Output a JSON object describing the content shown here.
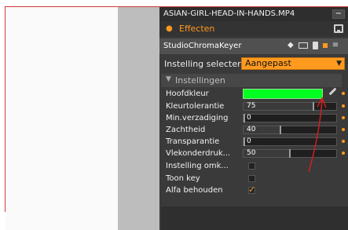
{
  "window": {
    "title": "ASIAN-GIRL-HEAD-IN-HANDS.MP4",
    "minimize_glyph": "−"
  },
  "tab": {
    "label": "Effecten",
    "dot": "●"
  },
  "effect": {
    "name": "StudioChromaKeyer",
    "icons": [
      "diamond-icon",
      "keyboard-icon",
      "trash-icon",
      "orange-square-icon",
      "menu-icon"
    ]
  },
  "preset": {
    "label": "Instelling selecter",
    "value": "Aangepast",
    "arrow": "▼"
  },
  "settings": {
    "header": "Instellingen",
    "rows": [
      {
        "label": "Hoofdkleur",
        "kind": "color",
        "color": "#00ff20"
      },
      {
        "label": "Kleurtolerantie",
        "kind": "slider",
        "value": "75",
        "fraction": 0.75
      },
      {
        "label": "Min.verzadiging",
        "kind": "slider",
        "value": "0",
        "fraction": 0
      },
      {
        "label": "Zachtheid",
        "kind": "slider",
        "value": "40",
        "fraction": 0.4
      },
      {
        "label": "Transparantie",
        "kind": "slider",
        "value": "0",
        "fraction": 0
      },
      {
        "label": "Vlekonderdruk...",
        "kind": "slider",
        "value": "50",
        "fraction": 0.5
      },
      {
        "label": "Instelling omk...",
        "kind": "checkbox",
        "checked": false
      },
      {
        "label": "Toon key",
        "kind": "checkbox",
        "checked": false
      },
      {
        "label": "Alfa behouden",
        "kind": "checkbox",
        "checked": true
      }
    ]
  },
  "colors": {
    "accent": "#ff9a1f",
    "panel": "#3a3a3a",
    "annotation": "#d11f1f"
  }
}
